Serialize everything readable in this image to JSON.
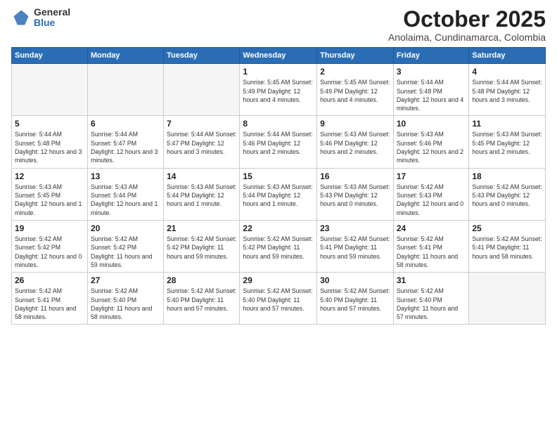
{
  "header": {
    "logo_general": "General",
    "logo_blue": "Blue",
    "title": "October 2025",
    "subtitle": "Anolaima, Cundinamarca, Colombia"
  },
  "days_of_week": [
    "Sunday",
    "Monday",
    "Tuesday",
    "Wednesday",
    "Thursday",
    "Friday",
    "Saturday"
  ],
  "weeks": [
    {
      "shaded": false,
      "days": [
        {
          "num": "",
          "info": ""
        },
        {
          "num": "",
          "info": ""
        },
        {
          "num": "",
          "info": ""
        },
        {
          "num": "1",
          "info": "Sunrise: 5:45 AM\nSunset: 5:49 PM\nDaylight: 12 hours\nand 4 minutes."
        },
        {
          "num": "2",
          "info": "Sunrise: 5:45 AM\nSunset: 5:49 PM\nDaylight: 12 hours\nand 4 minutes."
        },
        {
          "num": "3",
          "info": "Sunrise: 5:44 AM\nSunset: 5:48 PM\nDaylight: 12 hours\nand 4 minutes."
        },
        {
          "num": "4",
          "info": "Sunrise: 5:44 AM\nSunset: 5:48 PM\nDaylight: 12 hours\nand 3 minutes."
        }
      ]
    },
    {
      "shaded": true,
      "days": [
        {
          "num": "5",
          "info": "Sunrise: 5:44 AM\nSunset: 5:48 PM\nDaylight: 12 hours\nand 3 minutes."
        },
        {
          "num": "6",
          "info": "Sunrise: 5:44 AM\nSunset: 5:47 PM\nDaylight: 12 hours\nand 3 minutes."
        },
        {
          "num": "7",
          "info": "Sunrise: 5:44 AM\nSunset: 5:47 PM\nDaylight: 12 hours\nand 3 minutes."
        },
        {
          "num": "8",
          "info": "Sunrise: 5:44 AM\nSunset: 5:46 PM\nDaylight: 12 hours\nand 2 minutes."
        },
        {
          "num": "9",
          "info": "Sunrise: 5:43 AM\nSunset: 5:46 PM\nDaylight: 12 hours\nand 2 minutes."
        },
        {
          "num": "10",
          "info": "Sunrise: 5:43 AM\nSunset: 5:46 PM\nDaylight: 12 hours\nand 2 minutes."
        },
        {
          "num": "11",
          "info": "Sunrise: 5:43 AM\nSunset: 5:45 PM\nDaylight: 12 hours\nand 2 minutes."
        }
      ]
    },
    {
      "shaded": false,
      "days": [
        {
          "num": "12",
          "info": "Sunrise: 5:43 AM\nSunset: 5:45 PM\nDaylight: 12 hours\nand 1 minute."
        },
        {
          "num": "13",
          "info": "Sunrise: 5:43 AM\nSunset: 5:44 PM\nDaylight: 12 hours\nand 1 minute."
        },
        {
          "num": "14",
          "info": "Sunrise: 5:43 AM\nSunset: 5:44 PM\nDaylight: 12 hours\nand 1 minute."
        },
        {
          "num": "15",
          "info": "Sunrise: 5:43 AM\nSunset: 5:44 PM\nDaylight: 12 hours\nand 1 minute."
        },
        {
          "num": "16",
          "info": "Sunrise: 5:43 AM\nSunset: 5:43 PM\nDaylight: 12 hours\nand 0 minutes."
        },
        {
          "num": "17",
          "info": "Sunrise: 5:42 AM\nSunset: 5:43 PM\nDaylight: 12 hours\nand 0 minutes."
        },
        {
          "num": "18",
          "info": "Sunrise: 5:42 AM\nSunset: 5:43 PM\nDaylight: 12 hours\nand 0 minutes."
        }
      ]
    },
    {
      "shaded": true,
      "days": [
        {
          "num": "19",
          "info": "Sunrise: 5:42 AM\nSunset: 5:42 PM\nDaylight: 12 hours\nand 0 minutes."
        },
        {
          "num": "20",
          "info": "Sunrise: 5:42 AM\nSunset: 5:42 PM\nDaylight: 11 hours\nand 59 minutes."
        },
        {
          "num": "21",
          "info": "Sunrise: 5:42 AM\nSunset: 5:42 PM\nDaylight: 11 hours\nand 59 minutes."
        },
        {
          "num": "22",
          "info": "Sunrise: 5:42 AM\nSunset: 5:42 PM\nDaylight: 11 hours\nand 59 minutes."
        },
        {
          "num": "23",
          "info": "Sunrise: 5:42 AM\nSunset: 5:41 PM\nDaylight: 11 hours\nand 59 minutes."
        },
        {
          "num": "24",
          "info": "Sunrise: 5:42 AM\nSunset: 5:41 PM\nDaylight: 11 hours\nand 58 minutes."
        },
        {
          "num": "25",
          "info": "Sunrise: 5:42 AM\nSunset: 5:41 PM\nDaylight: 11 hours\nand 58 minutes."
        }
      ]
    },
    {
      "shaded": false,
      "days": [
        {
          "num": "26",
          "info": "Sunrise: 5:42 AM\nSunset: 5:41 PM\nDaylight: 11 hours\nand 58 minutes."
        },
        {
          "num": "27",
          "info": "Sunrise: 5:42 AM\nSunset: 5:40 PM\nDaylight: 11 hours\nand 58 minutes."
        },
        {
          "num": "28",
          "info": "Sunrise: 5:42 AM\nSunset: 5:40 PM\nDaylight: 11 hours\nand 57 minutes."
        },
        {
          "num": "29",
          "info": "Sunrise: 5:42 AM\nSunset: 5:40 PM\nDaylight: 11 hours\nand 57 minutes."
        },
        {
          "num": "30",
          "info": "Sunrise: 5:42 AM\nSunset: 5:40 PM\nDaylight: 11 hours\nand 57 minutes."
        },
        {
          "num": "31",
          "info": "Sunrise: 5:42 AM\nSunset: 5:40 PM\nDaylight: 11 hours\nand 57 minutes."
        },
        {
          "num": "",
          "info": ""
        }
      ]
    }
  ]
}
